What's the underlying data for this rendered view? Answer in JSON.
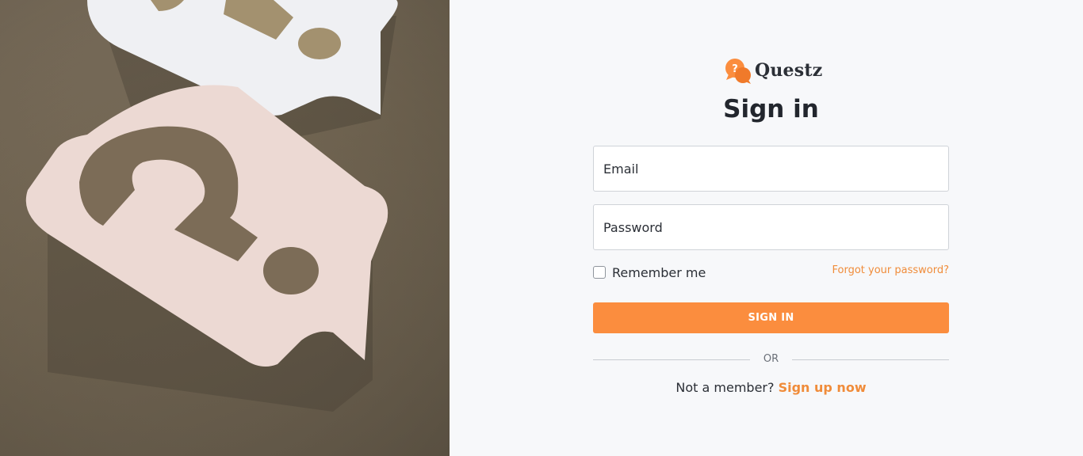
{
  "brand": {
    "name": "Questz",
    "icon": "question-chat-bubbles-icon",
    "accent": "#fb8d3e"
  },
  "hero": {
    "image": "paper-question-mark-speech-bubbles"
  },
  "form": {
    "title": "Sign in",
    "email_placeholder": "Email",
    "password_placeholder": "Password",
    "remember_label": "Remember me",
    "remember_checked": false,
    "forgot_label": "Forgot your password?",
    "submit_label": "SIGN IN",
    "divider_label": "OR",
    "signup_prompt": "Not a member?",
    "signup_link": "Sign up now"
  }
}
